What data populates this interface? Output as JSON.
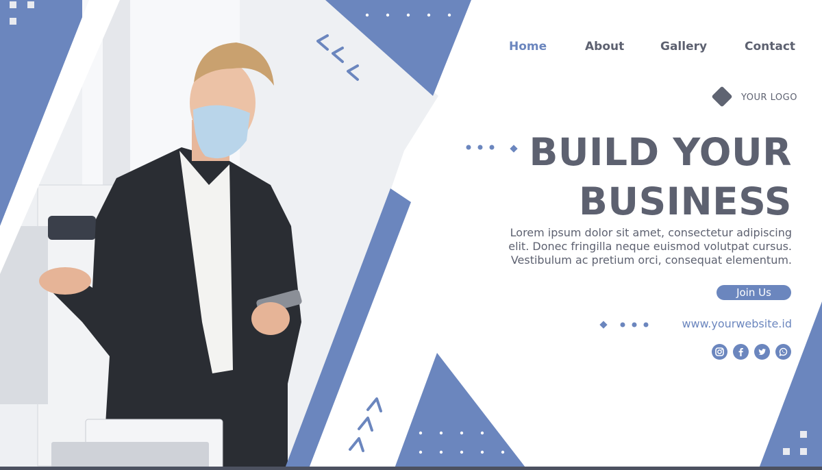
{
  "nav": {
    "items": [
      {
        "label": "Home",
        "active": true
      },
      {
        "label": "About",
        "active": false
      },
      {
        "label": "Gallery",
        "active": false
      },
      {
        "label": "Contact",
        "active": false
      }
    ]
  },
  "logo": {
    "text": "YOUR LOGO"
  },
  "hero": {
    "headline_line1": "BUILD YOUR",
    "headline_line2": "BUSINESS",
    "body_line1": "Lorem ipsum dolor sit amet, consectetur adipiscing",
    "body_line2": "elit. Donec fringilla neque euismod volutpat cursus.",
    "body_line3": "Vestibulum ac pretium orci, consequat elementum."
  },
  "cta": {
    "label": "Join Us"
  },
  "website": "www.yourwebsite.id",
  "social": [
    "instagram-icon",
    "facebook-icon",
    "twitter-icon",
    "whatsapp-icon"
  ],
  "colors": {
    "accent": "#6b86be",
    "text": "#5d6170",
    "background": "#ffffff"
  }
}
